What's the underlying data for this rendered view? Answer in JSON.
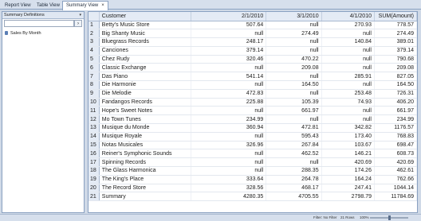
{
  "tabs": [
    {
      "label": "Report View",
      "active": false
    },
    {
      "label": "Table View",
      "active": false
    },
    {
      "label": "Summary View",
      "active": true
    }
  ],
  "tab_close_glyph": "×",
  "left_panel": {
    "title": "Summary Definitions",
    "search_value": "",
    "search_button": "›",
    "items": [
      "Sales By Month"
    ]
  },
  "grid": {
    "headers": {
      "customer": "Customer",
      "d1": "2/1/2010",
      "d2": "3/1/2010",
      "d3": "4/1/2010",
      "sum": "SUM(Amount)"
    },
    "rows": [
      {
        "n": "1",
        "customer": "Betty's Music Store",
        "d1": "507.64",
        "d2": "null",
        "d3": "270.93",
        "sum": "778.57"
      },
      {
        "n": "2",
        "customer": "Big Shanty Music",
        "d1": "null",
        "d2": "274.49",
        "d3": "null",
        "sum": "274.49"
      },
      {
        "n": "3",
        "customer": "Bluegrass Records",
        "d1": "248.17",
        "d2": "null",
        "d3": "140.84",
        "sum": "389.01"
      },
      {
        "n": "4",
        "customer": "Canciones",
        "d1": "379.14",
        "d2": "null",
        "d3": "null",
        "sum": "379.14"
      },
      {
        "n": "5",
        "customer": "Chez Rudy",
        "d1": "320.46",
        "d2": "470.22",
        "d3": "null",
        "sum": "790.68"
      },
      {
        "n": "6",
        "customer": "Classic Exchange",
        "d1": "null",
        "d2": "209.08",
        "d3": "null",
        "sum": "209.08"
      },
      {
        "n": "7",
        "customer": "Das Piano",
        "d1": "541.14",
        "d2": "null",
        "d3": "285.91",
        "sum": "827.05"
      },
      {
        "n": "8",
        "customer": "Die Harmonie",
        "d1": "null",
        "d2": "164.50",
        "d3": "null",
        "sum": "164.50"
      },
      {
        "n": "9",
        "customer": "Die Melodie",
        "d1": "472.83",
        "d2": "null",
        "d3": "253.48",
        "sum": "726.31"
      },
      {
        "n": "10",
        "customer": "Fandangos Records",
        "d1": "225.88",
        "d2": "105.39",
        "d3": "74.93",
        "sum": "406.20"
      },
      {
        "n": "11",
        "customer": "Hope's Sweet Notes",
        "d1": "null",
        "d2": "661.97",
        "d3": "null",
        "sum": "661.97"
      },
      {
        "n": "12",
        "customer": "Mo Town Tunes",
        "d1": "234.99",
        "d2": "null",
        "d3": "null",
        "sum": "234.99"
      },
      {
        "n": "13",
        "customer": "Musique du Monde",
        "d1": "360.94",
        "d2": "472.81",
        "d3": "342.82",
        "sum": "1176.57"
      },
      {
        "n": "14",
        "customer": "Musique Royale",
        "d1": "null",
        "d2": "595.43",
        "d3": "173.40",
        "sum": "768.83"
      },
      {
        "n": "15",
        "customer": "Notas Musicales",
        "d1": "326.96",
        "d2": "267.84",
        "d3": "103.67",
        "sum": "698.47"
      },
      {
        "n": "16",
        "customer": "Reiner's Symphonic Sounds",
        "d1": "null",
        "d2": "462.52",
        "d3": "146.21",
        "sum": "608.73"
      },
      {
        "n": "17",
        "customer": "Spinning Records",
        "d1": "null",
        "d2": "null",
        "d3": "420.69",
        "sum": "420.69"
      },
      {
        "n": "18",
        "customer": "The Glass Harmonica",
        "d1": "null",
        "d2": "288.35",
        "d3": "174.26",
        "sum": "462.61"
      },
      {
        "n": "19",
        "customer": "The King's Place",
        "d1": "333.64",
        "d2": "264.78",
        "d3": "164.24",
        "sum": "762.66"
      },
      {
        "n": "20",
        "customer": "The Record Store",
        "d1": "328.56",
        "d2": "468.17",
        "d3": "247.41",
        "sum": "1044.14"
      },
      {
        "n": "21",
        "customer": "Summary",
        "d1": "4280.35",
        "d2": "4705.55",
        "d3": "2798.79",
        "sum": "11784.69"
      }
    ]
  },
  "status": {
    "filter": "Filter: No Filter",
    "rows": "21 Rows",
    "zoom": "100%",
    "zoom_level": 0.5
  }
}
